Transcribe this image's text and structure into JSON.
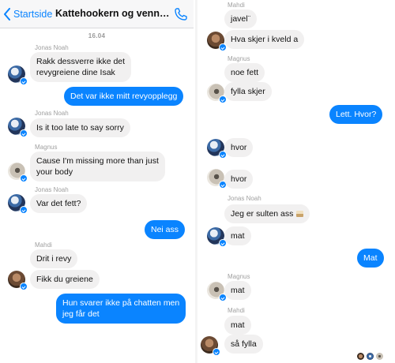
{
  "header": {
    "back_label": "Startside",
    "title": "Kattehookern og venne…",
    "back_icon": "chevron-left-icon",
    "call_icon": "phone-icon"
  },
  "colors": {
    "accent": "#0a84ff",
    "incoming_bubble": "#f1f0f0"
  },
  "left": {
    "date": "16.04",
    "names": [
      "Jonas Noah",
      "Jonas Noah",
      "Magnus",
      "Jonas Noah",
      "Mahdi"
    ],
    "messages": [
      {
        "line1": "Rakk dessverre  ikke det",
        "line2": "revygreiene dine Isak"
      },
      {
        "text": "Det var ikke mitt revyopplegg"
      },
      {
        "text": "Is it too late to say sorry"
      },
      {
        "line1": "Cause I'm missing more than just",
        "line2": "your body"
      },
      {
        "text": "Var det fett?"
      },
      {
        "text": "Nei ass"
      },
      {
        "text": "Drit i revy"
      },
      {
        "text": "Fikk du greiene"
      },
      {
        "line1": "Hun svarer ikke på chatten men",
        "line2": "jeg får det"
      }
    ]
  },
  "right": {
    "names": [
      "Mahdi",
      "Magnus",
      "Jonas Noah",
      "Magnus",
      "Mahdi"
    ],
    "messages": [
      {
        "text": "javel¨"
      },
      {
        "text": "Hva skjer i kveld a"
      },
      {
        "text": "noe fett"
      },
      {
        "text": "fylla skjer"
      },
      {
        "text": "Lett. Hvor?"
      },
      {
        "text": "hvor"
      },
      {
        "text": "hvor"
      },
      {
        "text": "Jeg er sulten ass"
      },
      {
        "text": "mat"
      },
      {
        "text": "Mat"
      },
      {
        "text": "mat"
      },
      {
        "text": "mat"
      },
      {
        "text": "så fylla"
      }
    ]
  }
}
